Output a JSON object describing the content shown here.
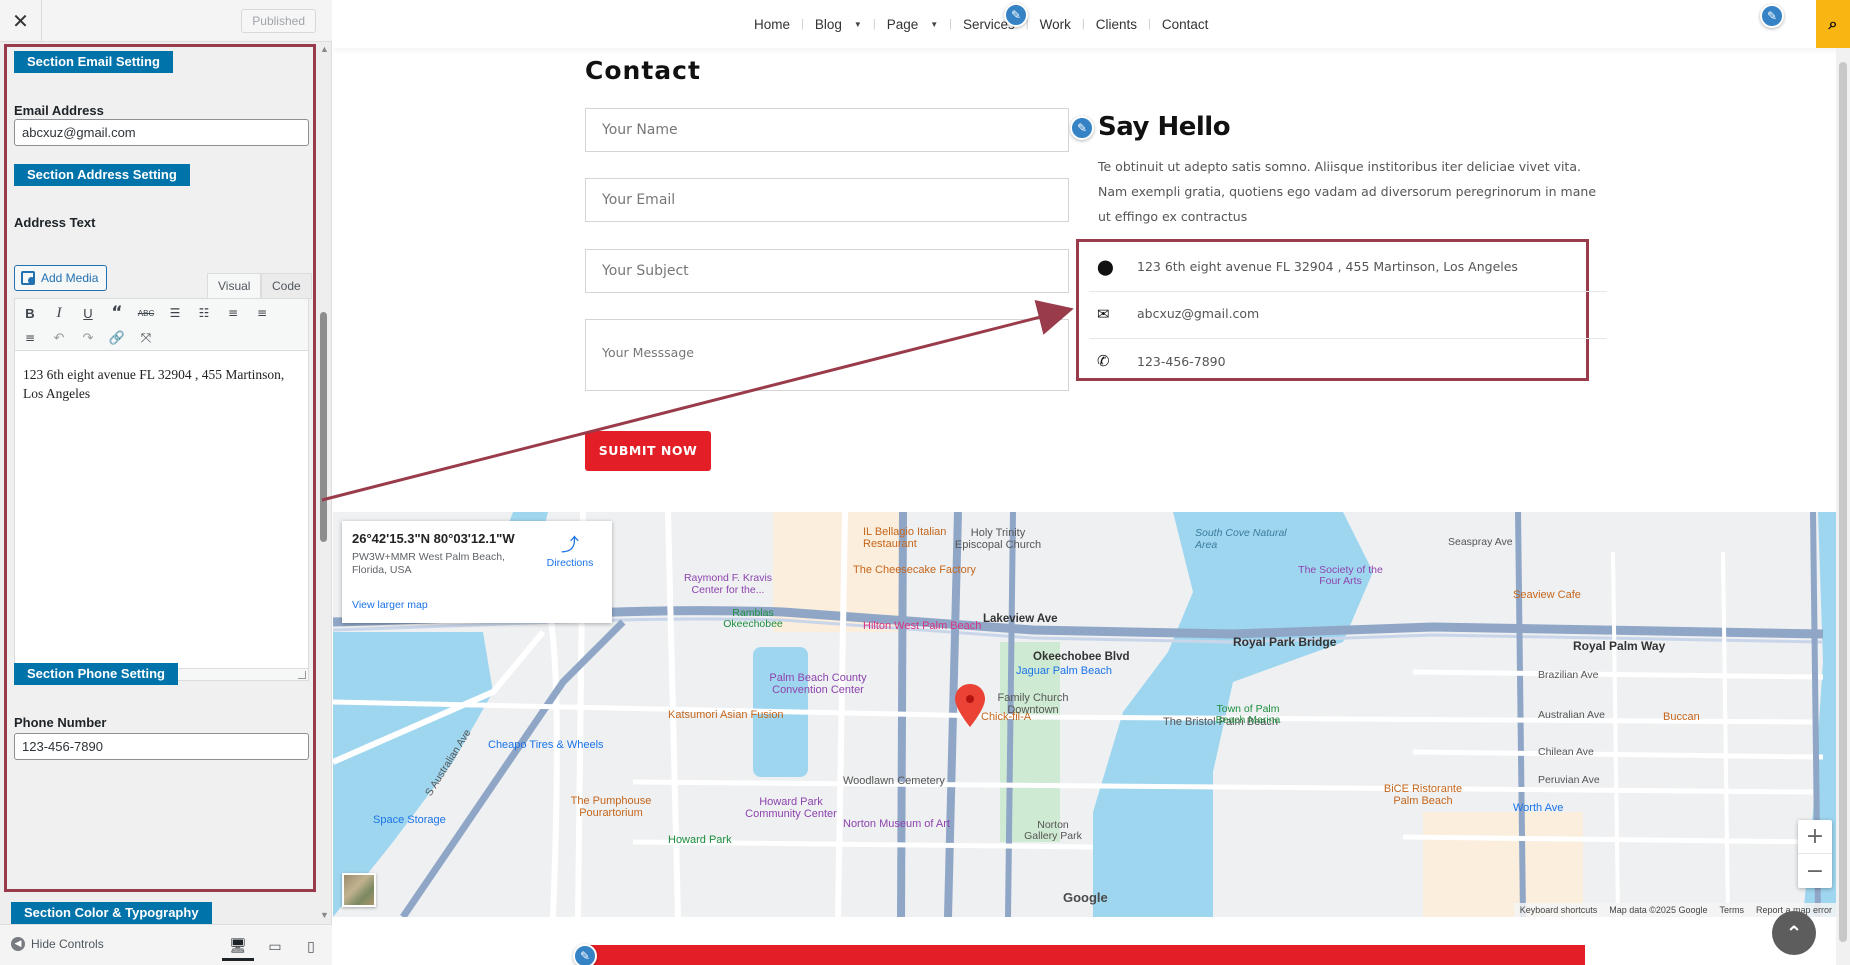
{
  "customizer": {
    "close_icon": "✕",
    "published_label": "Published",
    "sections": {
      "email": {
        "title": "Section Email Setting",
        "field_label": "Email Address",
        "value": "abcxuz@gmail.com"
      },
      "address": {
        "title": "Section Address Setting",
        "field_label": "Address Text",
        "add_media_label": "Add Media",
        "tab_visual": "Visual",
        "tab_code": "Code",
        "editor_content": "123 6th eight avenue FL 32904 , 455 Martinson, Los Angeles"
      },
      "phone": {
        "title": "Section Phone Setting",
        "field_label": "Phone Number",
        "value": "123-456-7890"
      },
      "color": {
        "title": "Section Color & Typography"
      }
    },
    "toolbar_icons": [
      "bold-icon",
      "italic-icon",
      "underline-icon",
      "blockquote-icon",
      "strikethrough-icon",
      "bullet-list-icon",
      "numbered-list-icon",
      "align-left-icon",
      "align-center-icon",
      "align-right-icon",
      "undo-icon",
      "redo-icon",
      "link-icon",
      "fullscreen-icon"
    ],
    "footer": {
      "hide_controls_label": "Hide Controls",
      "devices": [
        "desktop-icon",
        "tablet-icon",
        "mobile-icon"
      ]
    },
    "accent_color": "#0073aa",
    "highlight_color": "#9a3b4b"
  },
  "site": {
    "nav": {
      "items": [
        "Home",
        "Blog",
        "Page",
        "Services",
        "Work",
        "Clients",
        "Contact"
      ]
    },
    "search_icon": "search-icon",
    "contact": {
      "title": "Contact",
      "placeholders": {
        "name": "Your Name",
        "email": "Your Email",
        "subject": "Your Subject",
        "message": "Your Messsage"
      },
      "submit_label": "SUBMIT NOW"
    },
    "hello": {
      "title": "Say Hello",
      "text": "Te obtinuit ut adepto satis somno. Aliisque institoribus iter deliciae vivet vita. Nam exempli gratia, quotiens ego vadam ad diversorum peregrinorum in mane ut effingo ex contractus",
      "address": "123 6th eight avenue FL 32904 , 455 Martinson, Los Angeles",
      "email": "abcxuz@gmail.com",
      "phone": "123-456-7890"
    },
    "map": {
      "coordinates": "26°42'15.3\"N 80°03'12.1\"W",
      "address": "PW3W+MMR West Palm Beach, Florida, USA",
      "view_larger": "View larger map",
      "directions": "Directions",
      "labels": {
        "royal_park_bridge": "Royal Park Bridge",
        "royal_palm_way": "Royal Palm Way",
        "okeechobee": "Okeechobee Blvd",
        "lakeview": "Lakeview Ave",
        "cheesecake": "The Cheesecake Factory",
        "hilton": "Hilton West Palm Beach",
        "convention": "Palm Beach County Convention Center",
        "chickfila": "Chick-fil-A",
        "bristol": "The Bristol Palm Beach",
        "south_cove": "South Cove Natural Area",
        "seaview": "Seaview Cafe",
        "jaguar": "Jaguar Palm Beach",
        "kravis": "Raymond F. Kravis Center for the...",
        "cheapo": "Cheapo Tires & Wheels",
        "pumphouse": "The Pumphouse Pourartorium",
        "howard_park": "Howard Park Community Center",
        "norton": "Norton Museum of Art",
        "woodlawn": "Woodlawn Cemetery",
        "family_church": "Family Church Downtown",
        "katsumori": "Katsumori Asian Fusion",
        "bellagio": "IL Bellagio Italian Restaurant",
        "holy_trinity": "Holy Trinity Episcopal Church",
        "bice": "BiCE Ristorante Palm Beach",
        "buccan": "Buccan",
        "worth_ave": "Worth Ave",
        "town_palm": "Town of Palm Beach Marina",
        "society": "The Society of the Four Arts",
        "space_storage": "Space Storage",
        "howard_park_poi": "Howard Park",
        "norton_gallery": "Norton Gallery Park",
        "seaspray": "Seaspray Ave",
        "brazilian": "Brazilian Ave",
        "australian": "Australian Ave",
        "chilean": "Chilean Ave",
        "peruvian": "Peruvian Ave",
        "s_australian": "S Australian Ave",
        "ramblas": "Ramblas Okeechobee"
      },
      "footer": {
        "shortcuts": "Keyboard shortcuts",
        "data": "Map data ©2025 Google",
        "terms": "Terms",
        "report": "Report a map error"
      },
      "google": "Google"
    },
    "back_to_top_icon": "chevron-up-icon"
  }
}
